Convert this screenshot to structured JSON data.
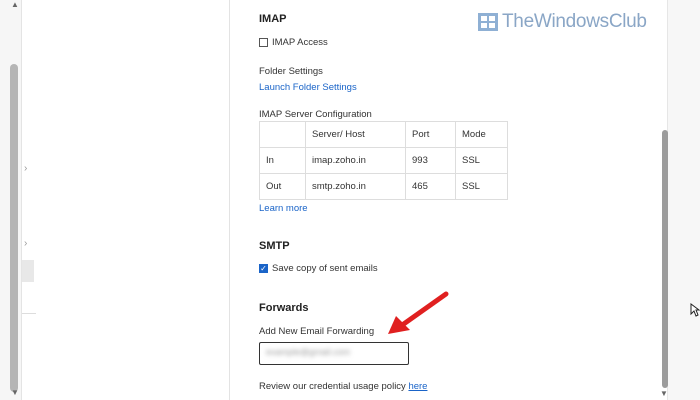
{
  "watermark": {
    "text": "TheWindowsClub"
  },
  "imap": {
    "heading": "IMAP",
    "access_label": "IMAP Access",
    "access_checked": false,
    "folder_settings_label": "Folder Settings",
    "launch_folder_settings_link": "Launch Folder Settings",
    "server_config_label": "IMAP Server Configuration",
    "table": {
      "headers": [
        "",
        "Server/ Host",
        "Port",
        "Mode"
      ],
      "rows": [
        [
          "In",
          "imap.zoho.in",
          "993",
          "SSL"
        ],
        [
          "Out",
          "smtp.zoho.in",
          "465",
          "SSL"
        ]
      ]
    },
    "learn_more_link": "Learn more"
  },
  "smtp": {
    "heading": "SMTP",
    "save_copy_label": "Save copy of sent emails",
    "save_copy_checked": true
  },
  "forwards": {
    "heading": "Forwards",
    "add_label": "Add New Email Forwarding",
    "input_value": "example@gmail.com"
  },
  "policy": {
    "text": "Review our credential usage policy ",
    "link": "here"
  },
  "colors": {
    "link": "#1a64c8",
    "arrow": "#e02020",
    "watermark": "#8aa6c6"
  }
}
